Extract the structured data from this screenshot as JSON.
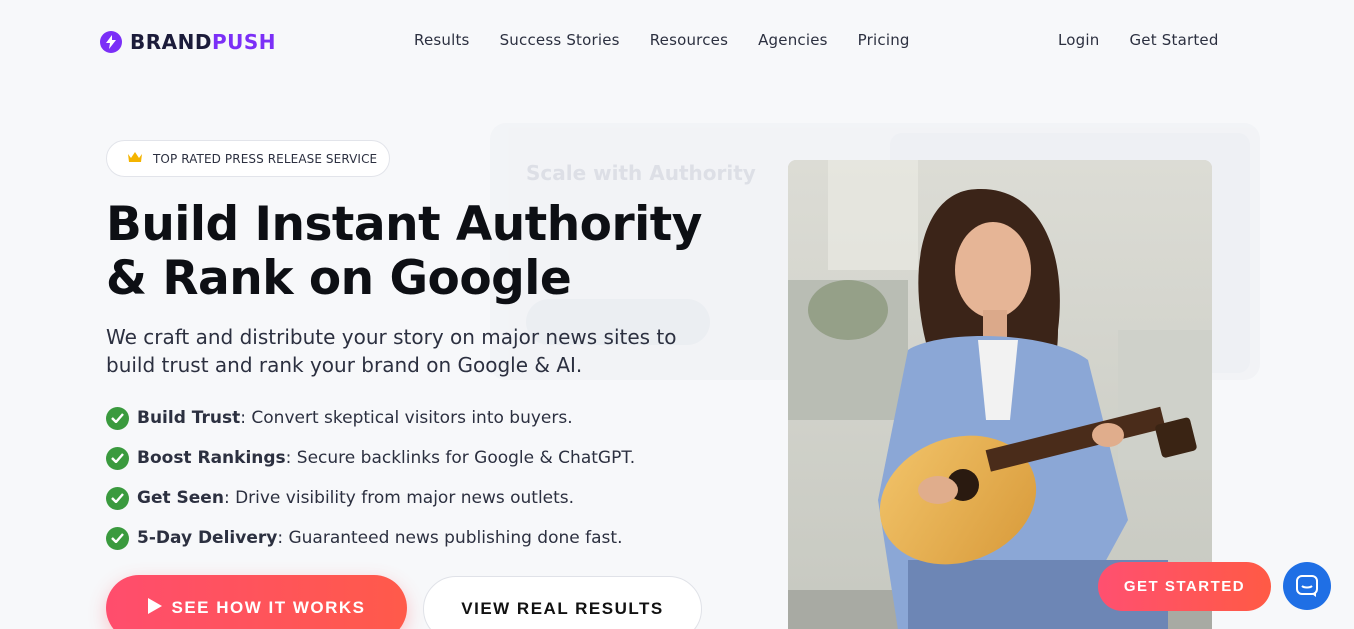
{
  "brand": {
    "name_part1": "BRAND",
    "name_part2": "PUSH",
    "accent": "#7b2ff7"
  },
  "nav": {
    "items": [
      "Results",
      "Success Stories",
      "Resources",
      "Agencies",
      "Pricing"
    ]
  },
  "auth": {
    "login": "Login",
    "get_started": "Get Started"
  },
  "hero": {
    "badge_icon": "crown-icon",
    "badge": "TOP RATED PRESS RELEASE SERVICE",
    "title_line1": "Build Instant Authority",
    "title_line2": "& Rank on Google",
    "subtitle": "We craft and distribute your story on major news sites to build trust and rank your brand on Google & AI.",
    "features": [
      {
        "bold": "Build Trust",
        "text": ": Convert skeptical visitors into buyers."
      },
      {
        "bold": "Boost Rankings",
        "text": ": Secure backlinks for Google & ChatGPT."
      },
      {
        "bold": "Get Seen",
        "text": ": Drive visibility from major news outlets."
      },
      {
        "bold": "5-Day Delivery",
        "text": ": Guaranteed news publishing done fast."
      }
    ],
    "cta_primary": "SEE HOW IT WORKS",
    "cta_secondary": "VIEW REAL RESULTS"
  },
  "background_card": {
    "title": "Scale with Authority"
  },
  "floating": {
    "cta": "GET STARTED",
    "chat_icon": "chat-icon"
  },
  "colors": {
    "cta": "#ff5a5a",
    "check": "#3a9a3e",
    "chat": "#1f6fe5"
  }
}
